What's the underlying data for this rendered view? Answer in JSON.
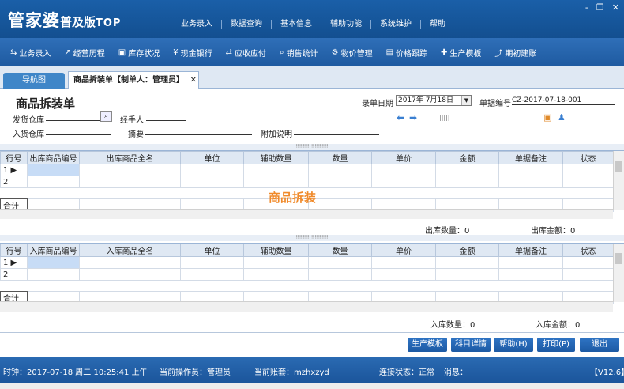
{
  "app": {
    "logo_main": "管家婆",
    "logo_sub": "普及版",
    "logo_top": "TOP"
  },
  "top_menu": [
    "业务录入",
    "数据查询",
    "基本信息",
    "辅助功能",
    "系统维护",
    "帮助"
  ],
  "window_controls": [
    "-",
    "❐",
    "✕"
  ],
  "toolbar": [
    {
      "icon": "⇆",
      "label": "业务录入"
    },
    {
      "icon": "↗",
      "label": "经营历程"
    },
    {
      "icon": "▣",
      "label": "库存状况"
    },
    {
      "icon": "¥",
      "label": "现金银行"
    },
    {
      "icon": "⇄",
      "label": "应收应付"
    },
    {
      "icon": "⌕",
      "label": "销售统计"
    },
    {
      "icon": "⚙",
      "label": "物价管理"
    },
    {
      "icon": "▤",
      "label": "价格跟踪"
    },
    {
      "icon": "✚",
      "label": "生产模板"
    },
    {
      "icon": "⤴",
      "label": "期初建账"
    }
  ],
  "tabs": {
    "nav": "导航图",
    "active": "商品拆装单【制单人：管理员】",
    "close": "✕"
  },
  "form": {
    "title": "商品拆装单",
    "date_label": "录单日期",
    "date_value": "2017年 7月18日",
    "doc_no_label": "单据编号",
    "doc_no_value": "CZ-2017-07-18-001",
    "out_store_label": "发货仓库",
    "handler_label": "经手人",
    "in_store_label": "入货仓库",
    "summary_label": "摘要",
    "extra_label": "附加说明"
  },
  "out_grid": {
    "headers": [
      "行号",
      "出库商品编号",
      "出库商品全名",
      "单位",
      "辅助数量",
      "数量",
      "单价",
      "金额",
      "单据备注",
      "状态"
    ],
    "rows": [
      "1",
      "2"
    ],
    "total_label": "合计",
    "qty_label": "出库数量：0",
    "amt_label": "出库金额：0"
  },
  "watermark": "商品拆装",
  "in_grid": {
    "headers": [
      "行号",
      "入库商品编号",
      "入库商品全名",
      "单位",
      "辅助数量",
      "数量",
      "单价",
      "金额",
      "单据备注",
      "状态"
    ],
    "rows": [
      "1",
      "2"
    ],
    "total_label": "合计",
    "qty_label": "入库数量：0",
    "amt_label": "入库金额：0"
  },
  "buttons": [
    "生产模板",
    "科目详情",
    "帮助(H)",
    "打印(P)",
    "退出"
  ],
  "status": {
    "clock": "时钟：2017-07-18 周二 10:25:41 上午",
    "operator": "当前操作员：管理员",
    "account": "当前账套：mzhxzyd",
    "connection": "连接状态：正常",
    "message": "消息：",
    "version": "【V12.6】"
  },
  "colors": {
    "brand": "#1a5fa8",
    "accent": "#f08a2a"
  }
}
